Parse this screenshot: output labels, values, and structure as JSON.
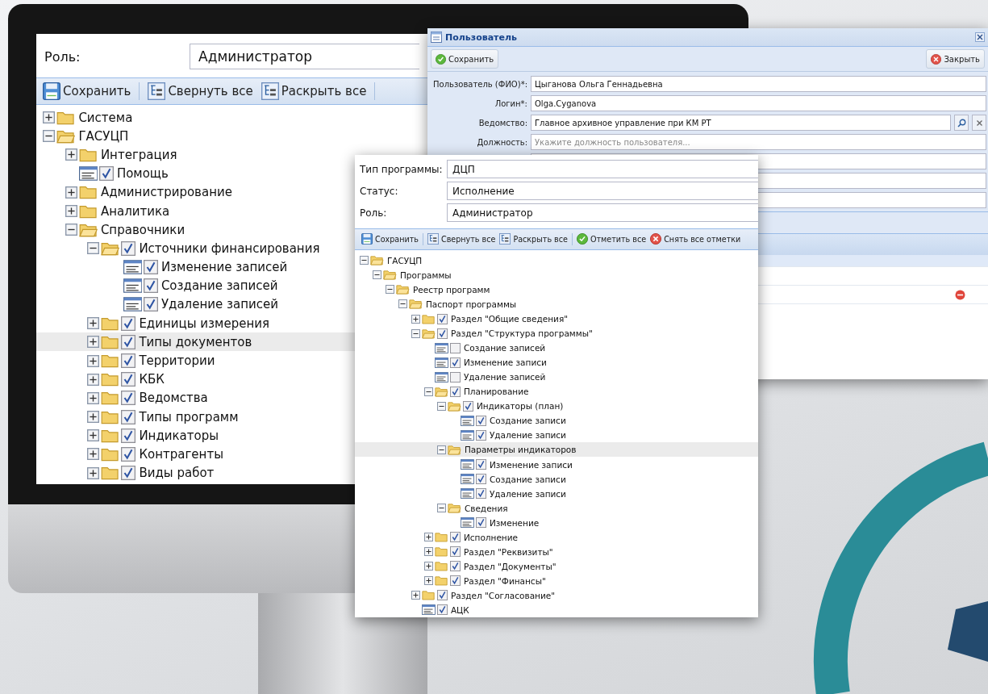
{
  "monitor_screen": {
    "role_label": "Роль:",
    "role_value": "Администратор",
    "toolbar": [
      {
        "label": "Сохранить",
        "kind": "save",
        "separator_after": true
      },
      {
        "label": "Свернуть все",
        "kind": "tree",
        "separator_after": false
      },
      {
        "label": "Раскрыть все",
        "kind": "tree",
        "separator_after": true
      }
    ],
    "tree": [
      {
        "label": "Система",
        "kind": "folder",
        "expanded": false
      },
      {
        "label": "ГАСУЦП",
        "kind": "folder",
        "expanded": true,
        "children": [
          {
            "label": "Интеграция",
            "kind": "folder",
            "expanded": false
          },
          {
            "label": "Помощь",
            "kind": "leaf",
            "checked": true
          },
          {
            "label": "Администрирование",
            "kind": "folder",
            "expanded": false
          },
          {
            "label": "Аналитика",
            "kind": "folder",
            "expanded": false
          },
          {
            "label": "Справочники",
            "kind": "folder",
            "expanded": true,
            "children": [
              {
                "label": "Источники финансирования",
                "kind": "folder",
                "expanded": true,
                "checked": true,
                "children": [
                  {
                    "label": "Изменение записей",
                    "kind": "leaf",
                    "checked": true
                  },
                  {
                    "label": "Создание записей",
                    "kind": "leaf",
                    "checked": true
                  },
                  {
                    "label": "Удаление записей",
                    "kind": "leaf",
                    "checked": true
                  }
                ]
              },
              {
                "label": "Единицы измерения",
                "kind": "folder",
                "expanded": false,
                "checked": true
              },
              {
                "label": "Типы документов",
                "kind": "folder",
                "expanded": false,
                "checked": true,
                "highlighted": true
              },
              {
                "label": "Территории",
                "kind": "folder",
                "expanded": false,
                "checked": true
              },
              {
                "label": "КБК",
                "kind": "folder",
                "expanded": false,
                "checked": true
              },
              {
                "label": "Ведомства",
                "kind": "folder",
                "expanded": false,
                "checked": true
              },
              {
                "label": "Типы программ",
                "kind": "folder",
                "expanded": false,
                "checked": true
              },
              {
                "label": "Индикаторы",
                "kind": "folder",
                "expanded": false,
                "checked": true
              },
              {
                "label": "Контрагенты",
                "kind": "folder",
                "expanded": false,
                "checked": true
              },
              {
                "label": "Виды работ",
                "kind": "folder",
                "expanded": false,
                "checked": true
              }
            ]
          }
        ]
      }
    ]
  },
  "user_window": {
    "title": "Пользователь",
    "toolbar": [
      {
        "label": "Сохранить",
        "kind": "check"
      },
      {
        "label": "Закрыть",
        "kind": "close"
      }
    ],
    "fields": [
      {
        "label": "Пользователь (ФИО)*:",
        "value": "Цыганова Ольга Геннадьевна",
        "lookup": false
      },
      {
        "label": "Логин*:",
        "value": "Olga.Cyganova",
        "lookup": false
      },
      {
        "label": "Ведомство:",
        "value": "Главное архивное управление при КМ РТ",
        "lookup": true
      },
      {
        "label": "Должность:",
        "placeholder": "Укажите должность пользователя...",
        "lookup": false
      }
    ]
  },
  "program_window": {
    "fields": [
      {
        "label": "Тип программы:",
        "value": "ДЦП"
      },
      {
        "label": "Статус:",
        "value": "Исполнение"
      },
      {
        "label": "Роль:",
        "value": "Администратор"
      }
    ],
    "toolbar": [
      {
        "label": "Сохранить",
        "kind": "save",
        "separator_after": true
      },
      {
        "label": "Свернуть все",
        "kind": "tree",
        "separator_after": false
      },
      {
        "label": "Раскрыть все",
        "kind": "tree",
        "separator_after": true
      },
      {
        "label": "Отметить все",
        "kind": "check",
        "separator_after": false
      },
      {
        "label": "Снять все отметки",
        "kind": "close",
        "separator_after": false
      }
    ],
    "tree": [
      {
        "label": "ГАСУЦП",
        "kind": "folder",
        "expanded": true,
        "children": [
          {
            "label": "Программы",
            "kind": "folder",
            "expanded": true,
            "children": [
              {
                "label": "Реестр программ",
                "kind": "folder",
                "expanded": true,
                "children": [
                  {
                    "label": "Паспорт программы",
                    "kind": "folder",
                    "expanded": true,
                    "children": [
                      {
                        "label": "Раздел \"Общие сведения\"",
                        "kind": "folder",
                        "expanded": false,
                        "checked": true
                      },
                      {
                        "label": "Раздел \"Структура программы\"",
                        "kind": "folder",
                        "expanded": true,
                        "checked": true,
                        "children": [
                          {
                            "label": "Создание записей",
                            "kind": "leaf",
                            "checked": false
                          },
                          {
                            "label": "Изменение записи",
                            "kind": "leaf",
                            "checked": true
                          },
                          {
                            "label": "Удаление записей",
                            "kind": "leaf",
                            "checked": false
                          },
                          {
                            "label": "Планирование",
                            "kind": "folder",
                            "expanded": true,
                            "checked": true,
                            "children": [
                              {
                                "label": "Индикаторы (план)",
                                "kind": "folder",
                                "expanded": true,
                                "checked": true,
                                "children": [
                                  {
                                    "label": "Создание записи",
                                    "kind": "leaf",
                                    "checked": true
                                  },
                                  {
                                    "label": "Удаление записи",
                                    "kind": "leaf",
                                    "checked": true
                                  }
                                ]
                              },
                              {
                                "label": "Параметры индикаторов",
                                "kind": "folder",
                                "expanded": true,
                                "highlighted": true,
                                "children": [
                                  {
                                    "label": "Изменение записи",
                                    "kind": "leaf",
                                    "checked": true
                                  },
                                  {
                                    "label": "Создание записи",
                                    "kind": "leaf",
                                    "checked": true
                                  },
                                  {
                                    "label": "Удаление записи",
                                    "kind": "leaf",
                                    "checked": true
                                  }
                                ]
                              },
                              {
                                "label": "Сведения",
                                "kind": "folder",
                                "expanded": true,
                                "children": [
                                  {
                                    "label": "Изменение",
                                    "kind": "leaf",
                                    "checked": true
                                  }
                                ]
                              }
                            ]
                          },
                          {
                            "label": "Исполнение",
                            "kind": "folder",
                            "expanded": false,
                            "checked": true
                          },
                          {
                            "label": "Раздел \"Реквизиты\"",
                            "kind": "folder",
                            "expanded": false,
                            "checked": true
                          },
                          {
                            "label": "Раздел \"Документы\"",
                            "kind": "folder",
                            "expanded": false,
                            "checked": true
                          },
                          {
                            "label": "Раздел \"Финансы\"",
                            "kind": "folder",
                            "expanded": false,
                            "checked": true
                          }
                        ]
                      },
                      {
                        "label": "Раздел \"Согласование\"",
                        "kind": "folder",
                        "expanded": false,
                        "checked": true
                      },
                      {
                        "label": "АЦК",
                        "kind": "leaf",
                        "checked": true
                      }
                    ]
                  }
                ]
              }
            ]
          }
        ]
      }
    ]
  }
}
